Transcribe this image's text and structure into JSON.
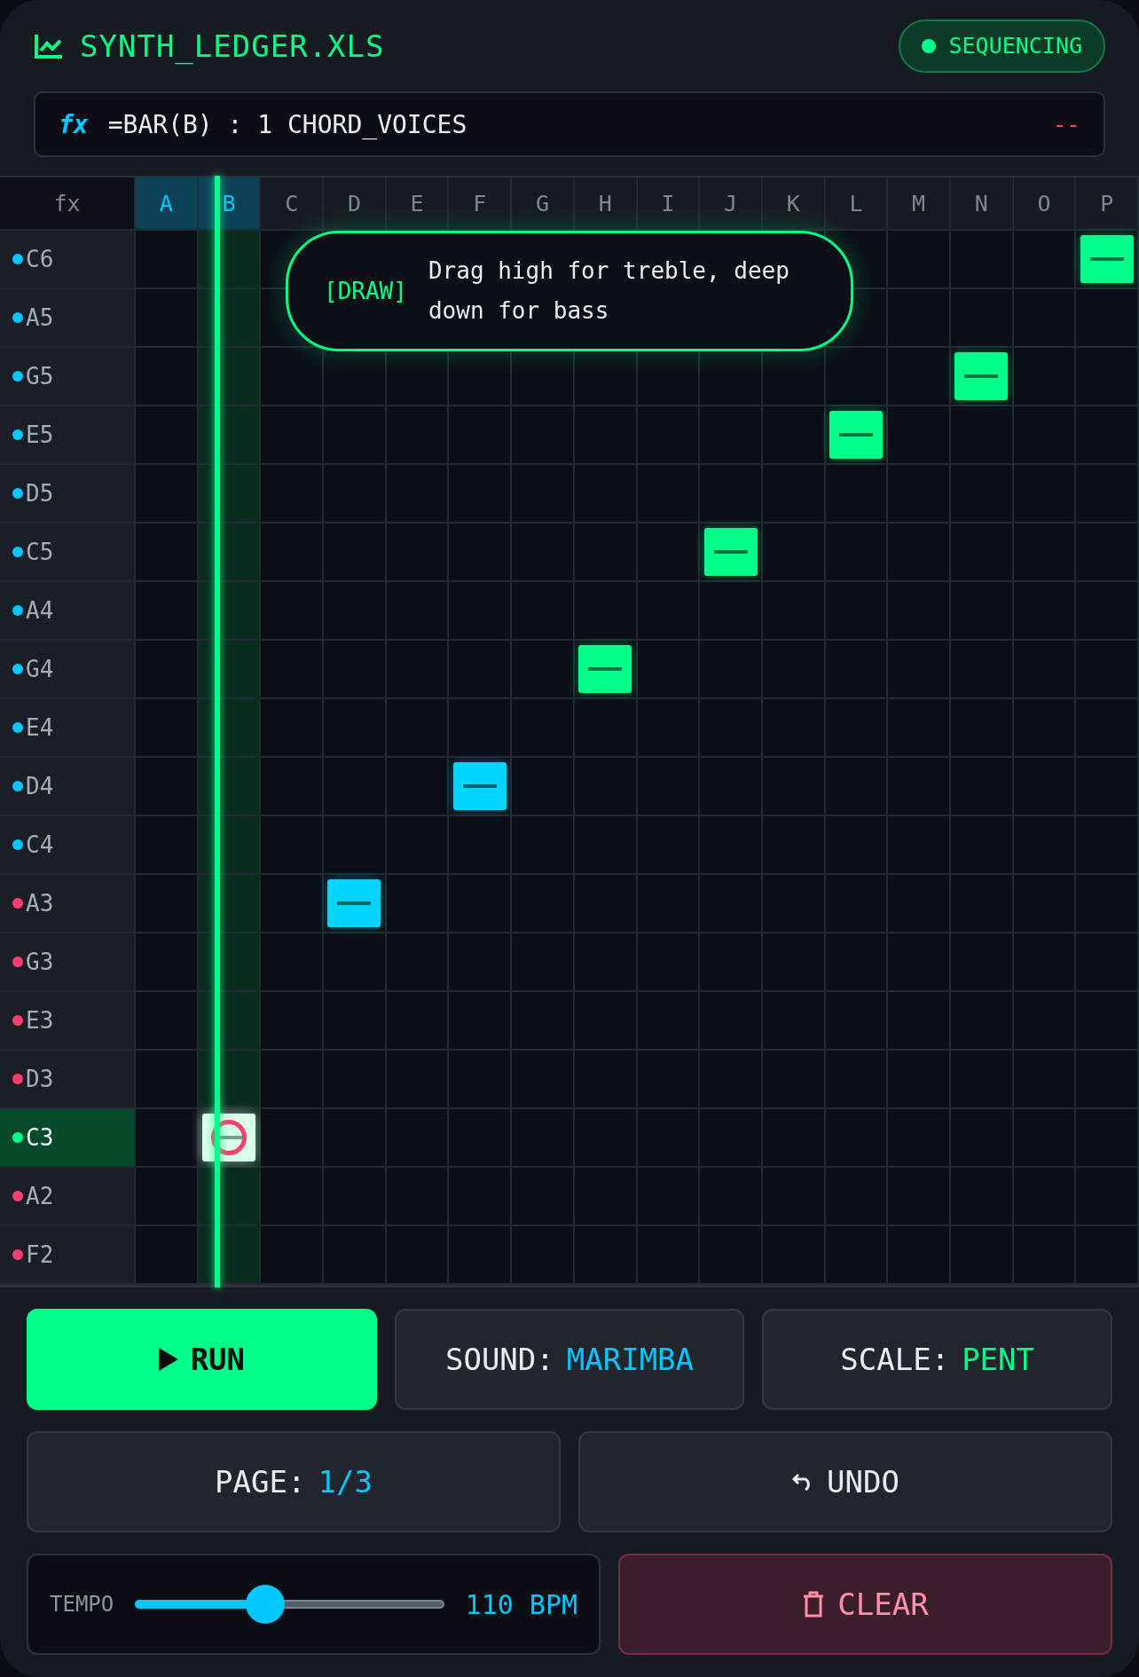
{
  "header": {
    "title": "SYNTH_LEDGER.XLS",
    "status": "SEQUENCING"
  },
  "formula_bar": {
    "label": "fx",
    "formula": "=BAR(B) : 1 CHORD_VOICES",
    "indicator": "--"
  },
  "grid": {
    "corner": "fx",
    "columns": [
      {
        "label": "A",
        "highlighted": true,
        "playhead": false
      },
      {
        "label": "B",
        "highlighted": true,
        "playhead": true
      },
      {
        "label": "C",
        "highlighted": false,
        "playhead": false
      },
      {
        "label": "D",
        "highlighted": false,
        "playhead": false
      },
      {
        "label": "E",
        "highlighted": false,
        "playhead": false
      },
      {
        "label": "F",
        "highlighted": false,
        "playhead": false
      },
      {
        "label": "G",
        "highlighted": false,
        "playhead": false
      },
      {
        "label": "H",
        "highlighted": false,
        "playhead": false
      },
      {
        "label": "I",
        "highlighted": false,
        "playhead": false
      },
      {
        "label": "J",
        "highlighted": false,
        "playhead": false
      },
      {
        "label": "K",
        "highlighted": false,
        "playhead": false
      },
      {
        "label": "L",
        "highlighted": false,
        "playhead": false
      },
      {
        "label": "M",
        "highlighted": false,
        "playhead": false
      },
      {
        "label": "N",
        "highlighted": false,
        "playhead": false
      },
      {
        "label": "O",
        "highlighted": false,
        "playhead": false
      },
      {
        "label": "P",
        "highlighted": false,
        "playhead": false
      }
    ],
    "rows": [
      {
        "note": "C6",
        "color": "#00c8ff",
        "selected": false,
        "cells": [
          {
            "kind": "empty"
          },
          {
            "kind": "empty"
          },
          {
            "kind": "empty"
          },
          {
            "kind": "empty"
          },
          {
            "kind": "covered"
          },
          {
            "kind": "covered"
          },
          {
            "kind": "covered"
          },
          {
            "kind": "covered"
          },
          {
            "kind": "empty"
          },
          {
            "kind": "empty"
          },
          {
            "kind": "empty"
          },
          {
            "kind": "empty"
          },
          {
            "kind": "empty"
          },
          {
            "kind": "empty"
          },
          {
            "kind": "empty"
          },
          {
            "kind": "block",
            "color": "#00ff88"
          }
        ]
      },
      {
        "note": "A5",
        "color": "#00c8ff",
        "selected": false,
        "cells": [
          {
            "kind": "empty"
          },
          {
            "kind": "empty"
          },
          {
            "kind": "empty"
          },
          {
            "kind": "empty"
          },
          {
            "kind": "empty"
          },
          {
            "kind": "empty"
          },
          {
            "kind": "empty"
          },
          {
            "kind": "empty"
          },
          {
            "kind": "empty"
          },
          {
            "kind": "empty"
          },
          {
            "kind": "empty"
          },
          {
            "kind": "empty"
          },
          {
            "kind": "empty"
          },
          {
            "kind": "empty"
          },
          {
            "kind": "empty"
          },
          {
            "kind": "empty"
          }
        ]
      },
      {
        "note": "G5",
        "color": "#00c8ff",
        "selected": false,
        "cells": [
          {
            "kind": "empty"
          },
          {
            "kind": "empty"
          },
          {
            "kind": "empty"
          },
          {
            "kind": "empty"
          },
          {
            "kind": "empty"
          },
          {
            "kind": "empty"
          },
          {
            "kind": "empty"
          },
          {
            "kind": "empty"
          },
          {
            "kind": "empty"
          },
          {
            "kind": "empty"
          },
          {
            "kind": "empty"
          },
          {
            "kind": "empty"
          },
          {
            "kind": "empty"
          },
          {
            "kind": "block",
            "color": "#00ff88"
          },
          {
            "kind": "empty"
          },
          {
            "kind": "empty"
          }
        ]
      },
      {
        "note": "E5",
        "color": "#00c8ff",
        "selected": false,
        "cells": [
          {
            "kind": "empty"
          },
          {
            "kind": "empty"
          },
          {
            "kind": "empty"
          },
          {
            "kind": "empty"
          },
          {
            "kind": "empty"
          },
          {
            "kind": "empty"
          },
          {
            "kind": "empty"
          },
          {
            "kind": "empty"
          },
          {
            "kind": "empty"
          },
          {
            "kind": "empty"
          },
          {
            "kind": "empty"
          },
          {
            "kind": "block",
            "color": "#00ff88"
          },
          {
            "kind": "empty"
          },
          {
            "kind": "empty"
          },
          {
            "kind": "empty"
          },
          {
            "kind": "empty"
          }
        ]
      },
      {
        "note": "D5",
        "color": "#00c8ff",
        "selected": false,
        "cells": [
          {
            "kind": "empty"
          },
          {
            "kind": "empty"
          },
          {
            "kind": "empty"
          },
          {
            "kind": "empty"
          },
          {
            "kind": "empty"
          },
          {
            "kind": "empty"
          },
          {
            "kind": "empty"
          },
          {
            "kind": "empty"
          },
          {
            "kind": "empty"
          },
          {
            "kind": "empty"
          },
          {
            "kind": "empty"
          },
          {
            "kind": "empty"
          },
          {
            "kind": "empty"
          },
          {
            "kind": "empty"
          },
          {
            "kind": "empty"
          },
          {
            "kind": "empty"
          }
        ]
      },
      {
        "note": "C5",
        "color": "#00c8ff",
        "selected": false,
        "cells": [
          {
            "kind": "empty"
          },
          {
            "kind": "empty"
          },
          {
            "kind": "empty"
          },
          {
            "kind": "empty"
          },
          {
            "kind": "empty"
          },
          {
            "kind": "empty"
          },
          {
            "kind": "empty"
          },
          {
            "kind": "empty"
          },
          {
            "kind": "empty"
          },
          {
            "kind": "block",
            "color": "#00ff88"
          },
          {
            "kind": "empty"
          },
          {
            "kind": "empty"
          },
          {
            "kind": "empty"
          },
          {
            "kind": "empty"
          },
          {
            "kind": "empty"
          },
          {
            "kind": "empty"
          }
        ]
      },
      {
        "note": "A4",
        "color": "#00c8ff",
        "selected": false,
        "cells": [
          {
            "kind": "empty"
          },
          {
            "kind": "empty"
          },
          {
            "kind": "empty"
          },
          {
            "kind": "empty"
          },
          {
            "kind": "empty"
          },
          {
            "kind": "empty"
          },
          {
            "kind": "empty"
          },
          {
            "kind": "empty"
          },
          {
            "kind": "empty"
          },
          {
            "kind": "empty"
          },
          {
            "kind": "empty"
          },
          {
            "kind": "empty"
          },
          {
            "kind": "empty"
          },
          {
            "kind": "empty"
          },
          {
            "kind": "empty"
          },
          {
            "kind": "empty"
          }
        ]
      },
      {
        "note": "G4",
        "color": "#00c8ff",
        "selected": false,
        "cells": [
          {
            "kind": "empty"
          },
          {
            "kind": "empty"
          },
          {
            "kind": "empty"
          },
          {
            "kind": "empty"
          },
          {
            "kind": "empty"
          },
          {
            "kind": "empty"
          },
          {
            "kind": "empty"
          },
          {
            "kind": "block",
            "color": "#00ff88"
          },
          {
            "kind": "empty"
          },
          {
            "kind": "empty"
          },
          {
            "kind": "empty"
          },
          {
            "kind": "empty"
          },
          {
            "kind": "empty"
          },
          {
            "kind": "empty"
          },
          {
            "kind": "empty"
          },
          {
            "kind": "empty"
          }
        ]
      },
      {
        "note": "E4",
        "color": "#00c8ff",
        "selected": false,
        "cells": [
          {
            "kind": "empty"
          },
          {
            "kind": "empty"
          },
          {
            "kind": "empty"
          },
          {
            "kind": "empty"
          },
          {
            "kind": "empty"
          },
          {
            "kind": "empty"
          },
          {
            "kind": "empty"
          },
          {
            "kind": "empty"
          },
          {
            "kind": "empty"
          },
          {
            "kind": "empty"
          },
          {
            "kind": "empty"
          },
          {
            "kind": "empty"
          },
          {
            "kind": "empty"
          },
          {
            "kind": "empty"
          },
          {
            "kind": "empty"
          },
          {
            "kind": "empty"
          }
        ]
      },
      {
        "note": "D4",
        "color": "#00c8ff",
        "selected": false,
        "cells": [
          {
            "kind": "empty"
          },
          {
            "kind": "empty"
          },
          {
            "kind": "empty"
          },
          {
            "kind": "empty"
          },
          {
            "kind": "empty"
          },
          {
            "kind": "block",
            "color": "#00d4ff"
          },
          {
            "kind": "empty"
          },
          {
            "kind": "empty"
          },
          {
            "kind": "empty"
          },
          {
            "kind": "empty"
          },
          {
            "kind": "empty"
          },
          {
            "kind": "empty"
          },
          {
            "kind": "empty"
          },
          {
            "kind": "empty"
          },
          {
            "kind": "empty"
          },
          {
            "kind": "empty"
          }
        ]
      },
      {
        "note": "C4",
        "color": "#00c8ff",
        "selected": false,
        "cells": [
          {
            "kind": "empty"
          },
          {
            "kind": "empty"
          },
          {
            "kind": "empty"
          },
          {
            "kind": "empty"
          },
          {
            "kind": "empty"
          },
          {
            "kind": "empty"
          },
          {
            "kind": "empty"
          },
          {
            "kind": "empty"
          },
          {
            "kind": "empty"
          },
          {
            "kind": "empty"
          },
          {
            "kind": "empty"
          },
          {
            "kind": "empty"
          },
          {
            "kind": "empty"
          },
          {
            "kind": "empty"
          },
          {
            "kind": "empty"
          },
          {
            "kind": "empty"
          }
        ]
      },
      {
        "note": "A3",
        "color": "#ff3d6e",
        "selected": false,
        "cells": [
          {
            "kind": "empty"
          },
          {
            "kind": "empty"
          },
          {
            "kind": "empty"
          },
          {
            "kind": "block",
            "color": "#00d4ff"
          },
          {
            "kind": "empty"
          },
          {
            "kind": "empty"
          },
          {
            "kind": "empty"
          },
          {
            "kind": "empty"
          },
          {
            "kind": "empty"
          },
          {
            "kind": "empty"
          },
          {
            "kind": "empty"
          },
          {
            "kind": "empty"
          },
          {
            "kind": "empty"
          },
          {
            "kind": "empty"
          },
          {
            "kind": "empty"
          },
          {
            "kind": "empty"
          }
        ]
      },
      {
        "note": "G3",
        "color": "#ff3d6e",
        "selected": false,
        "cells": [
          {
            "kind": "empty"
          },
          {
            "kind": "empty"
          },
          {
            "kind": "empty"
          },
          {
            "kind": "empty"
          },
          {
            "kind": "empty"
          },
          {
            "kind": "empty"
          },
          {
            "kind": "empty"
          },
          {
            "kind": "empty"
          },
          {
            "kind": "empty"
          },
          {
            "kind": "empty"
          },
          {
            "kind": "empty"
          },
          {
            "kind": "empty"
          },
          {
            "kind": "empty"
          },
          {
            "kind": "empty"
          },
          {
            "kind": "empty"
          },
          {
            "kind": "empty"
          }
        ]
      },
      {
        "note": "E3",
        "color": "#ff3d6e",
        "selected": false,
        "cells": [
          {
            "kind": "empty"
          },
          {
            "kind": "empty"
          },
          {
            "kind": "empty"
          },
          {
            "kind": "empty"
          },
          {
            "kind": "empty"
          },
          {
            "kind": "empty"
          },
          {
            "kind": "empty"
          },
          {
            "kind": "empty"
          },
          {
            "kind": "empty"
          },
          {
            "kind": "empty"
          },
          {
            "kind": "empty"
          },
          {
            "kind": "empty"
          },
          {
            "kind": "empty"
          },
          {
            "kind": "empty"
          },
          {
            "kind": "empty"
          },
          {
            "kind": "empty"
          }
        ]
      },
      {
        "note": "D3",
        "color": "#ff3d6e",
        "selected": false,
        "cells": [
          {
            "kind": "empty"
          },
          {
            "kind": "empty"
          },
          {
            "kind": "empty"
          },
          {
            "kind": "empty"
          },
          {
            "kind": "empty"
          },
          {
            "kind": "empty"
          },
          {
            "kind": "empty"
          },
          {
            "kind": "empty"
          },
          {
            "kind": "empty"
          },
          {
            "kind": "empty"
          },
          {
            "kind": "empty"
          },
          {
            "kind": "empty"
          },
          {
            "kind": "empty"
          },
          {
            "kind": "empty"
          },
          {
            "kind": "empty"
          },
          {
            "kind": "empty"
          }
        ]
      },
      {
        "note": "C3",
        "color": "#00ff88",
        "selected": true,
        "cells": [
          {
            "kind": "empty"
          },
          {
            "kind": "cursor",
            "color": "#d8ffe9"
          },
          {
            "kind": "empty"
          },
          {
            "kind": "empty"
          },
          {
            "kind": "empty"
          },
          {
            "kind": "empty"
          },
          {
            "kind": "empty"
          },
          {
            "kind": "empty"
          },
          {
            "kind": "empty"
          },
          {
            "kind": "empty"
          },
          {
            "kind": "empty"
          },
          {
            "kind": "empty"
          },
          {
            "kind": "empty"
          },
          {
            "kind": "empty"
          },
          {
            "kind": "empty"
          },
          {
            "kind": "empty"
          }
        ]
      },
      {
        "note": "A2",
        "color": "#ff3d6e",
        "selected": false,
        "cells": [
          {
            "kind": "empty"
          },
          {
            "kind": "empty"
          },
          {
            "kind": "empty"
          },
          {
            "kind": "empty"
          },
          {
            "kind": "empty"
          },
          {
            "kind": "empty"
          },
          {
            "kind": "empty"
          },
          {
            "kind": "empty"
          },
          {
            "kind": "empty"
          },
          {
            "kind": "empty"
          },
          {
            "kind": "empty"
          },
          {
            "kind": "empty"
          },
          {
            "kind": "empty"
          },
          {
            "kind": "empty"
          },
          {
            "kind": "empty"
          },
          {
            "kind": "empty"
          }
        ]
      },
      {
        "note": "F2",
        "color": "#ff3d6e",
        "selected": false,
        "cells": [
          {
            "kind": "empty"
          },
          {
            "kind": "empty"
          },
          {
            "kind": "empty"
          },
          {
            "kind": "empty"
          },
          {
            "kind": "empty"
          },
          {
            "kind": "empty"
          },
          {
            "kind": "empty"
          },
          {
            "kind": "empty"
          },
          {
            "kind": "empty"
          },
          {
            "kind": "empty"
          },
          {
            "kind": "empty"
          },
          {
            "kind": "empty"
          },
          {
            "kind": "empty"
          },
          {
            "kind": "empty"
          },
          {
            "kind": "empty"
          },
          {
            "kind": "empty"
          }
        ]
      }
    ],
    "tooltip": {
      "tag": "[DRAW]",
      "text": "Drag high for treble, deep down for bass"
    }
  },
  "controls": {
    "run": "RUN",
    "sound": {
      "label": "SOUND:",
      "value": "MARIMBA"
    },
    "scale": {
      "label": "SCALE:",
      "value": "PENT"
    },
    "page": {
      "label": "PAGE:",
      "value": "1/3"
    },
    "undo": "UNDO",
    "tempo": {
      "label": "TEMPO",
      "level": 0.42,
      "reading": "110 BPM"
    },
    "clear": "CLEAR"
  }
}
